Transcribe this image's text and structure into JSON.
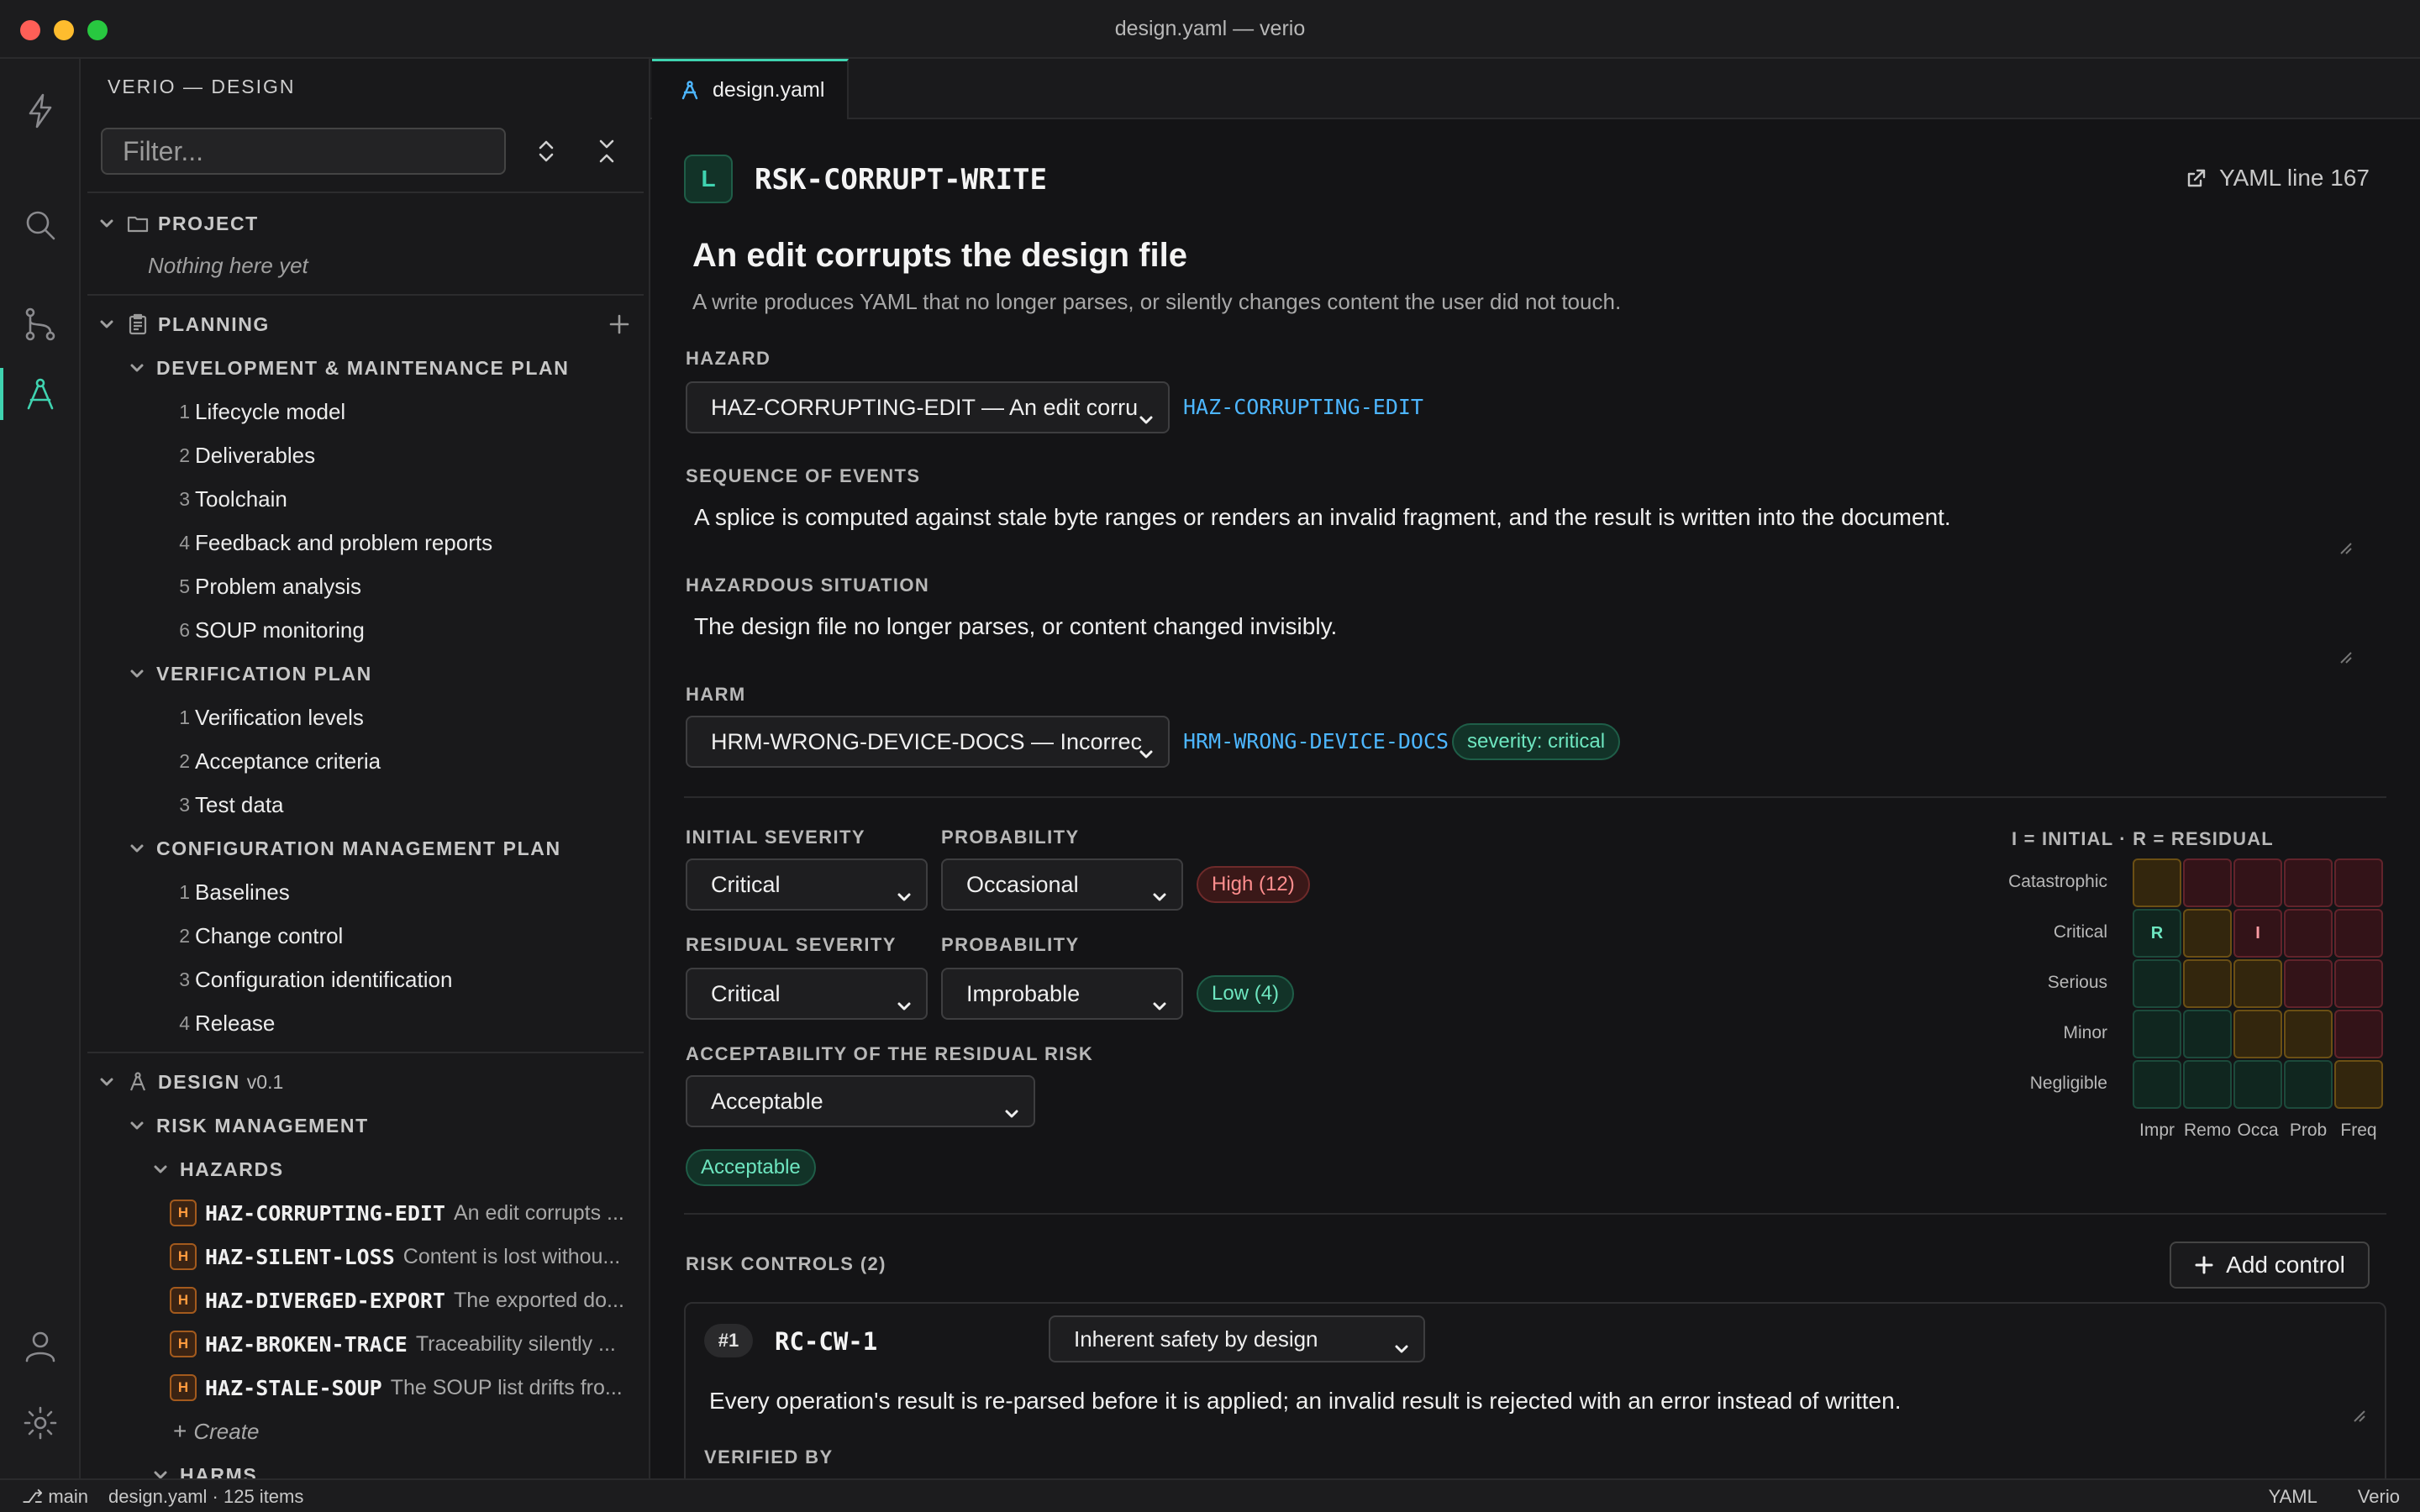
{
  "window": {
    "title": "design.yaml — verio"
  },
  "activity_bar": {
    "icons": [
      "bolt-icon",
      "search-icon",
      "source-control-icon",
      "design-compass-icon",
      "account-icon",
      "settings-icon"
    ],
    "active": "design-compass-icon",
    "accent_color": "#3fd3b0"
  },
  "sidebar": {
    "title": "VERIO — DESIGN",
    "filter_placeholder": "Filter...",
    "project": {
      "label": "PROJECT",
      "empty_text": "Nothing here yet"
    },
    "planning": {
      "label": "PLANNING",
      "groups": [
        {
          "label": "DEVELOPMENT & MAINTENANCE PLAN",
          "items": [
            {
              "num": "1",
              "label": "Lifecycle model"
            },
            {
              "num": "2",
              "label": "Deliverables"
            },
            {
              "num": "3",
              "label": "Toolchain"
            },
            {
              "num": "4",
              "label": "Feedback and problem reports"
            },
            {
              "num": "5",
              "label": "Problem analysis"
            },
            {
              "num": "6",
              "label": "SOUP monitoring"
            }
          ]
        },
        {
          "label": "VERIFICATION PLAN",
          "items": [
            {
              "num": "1",
              "label": "Verification levels"
            },
            {
              "num": "2",
              "label": "Acceptance criteria"
            },
            {
              "num": "3",
              "label": "Test data"
            }
          ]
        },
        {
          "label": "CONFIGURATION MANAGEMENT PLAN",
          "items": [
            {
              "num": "1",
              "label": "Baselines"
            },
            {
              "num": "2",
              "label": "Change control"
            },
            {
              "num": "3",
              "label": "Configuration identification"
            },
            {
              "num": "4",
              "label": "Release"
            }
          ]
        }
      ]
    },
    "design": {
      "label": "DESIGN",
      "version": "v0.1",
      "risk_management": "RISK MANAGEMENT",
      "hazards_label": "HAZARDS",
      "hazards": [
        {
          "badge": "H",
          "id": "HAZ-CORRUPTING-EDIT",
          "desc": "An edit corrupts ..."
        },
        {
          "badge": "H",
          "id": "HAZ-SILENT-LOSS",
          "desc": "Content is lost withou..."
        },
        {
          "badge": "H",
          "id": "HAZ-DIVERGED-EXPORT",
          "desc": "The exported do..."
        },
        {
          "badge": "H",
          "id": "HAZ-BROKEN-TRACE",
          "desc": "Traceability silently ..."
        },
        {
          "badge": "H",
          "id": "HAZ-STALE-SOUP",
          "desc": "The SOUP list drifts fro..."
        }
      ],
      "create_label": "Create",
      "harms_label": "HARMS"
    }
  },
  "tab": {
    "label": "design.yaml"
  },
  "risk": {
    "badge": "L",
    "id": "RSK-CORRUPT-WRITE",
    "yaml_link": "YAML line 167",
    "title": "An edit corrupts the design file",
    "subtitle": "A write produces YAML that no longer parses, or silently changes content the user did not touch.",
    "hazard": {
      "label": "HAZARD",
      "selected": "HAZ-CORRUPTING-EDIT — An edit corru",
      "ref": "HAZ-CORRUPTING-EDIT"
    },
    "sequence": {
      "label": "SEQUENCE OF EVENTS",
      "text": "A splice is computed against stale byte ranges or renders an invalid fragment, and the result is written into the document."
    },
    "hazardous_situation": {
      "label": "HAZARDOUS SITUATION",
      "text": "The design file no longer parses, or content changed invisibly."
    },
    "harm": {
      "label": "HARM",
      "selected": "HRM-WRONG-DEVICE-DOCS — Incorrec",
      "ref": "HRM-WRONG-DEVICE-DOCS",
      "severity_badge": "severity: critical"
    },
    "initial": {
      "severity_label": "INITIAL SEVERITY",
      "severity": "Critical",
      "probability_label": "PROBABILITY",
      "probability": "Occasional",
      "level": "High (12)"
    },
    "residual": {
      "severity_label": "RESIDUAL SEVERITY",
      "severity": "Critical",
      "probability_label": "PROBABILITY",
      "probability": "Improbable",
      "level": "Low (4)"
    },
    "acceptability": {
      "label": "ACCEPTABILITY OF THE RESIDUAL RISK",
      "selected": "Acceptable",
      "badge": "Acceptable"
    },
    "matrix": {
      "legend": "I = INITIAL · R = RESIDUAL",
      "rows": [
        "Catastrophic",
        "Critical",
        "Serious",
        "Minor",
        "Negligible"
      ],
      "cols": [
        "Impr",
        "Remo",
        "Occa",
        "Prob",
        "Freq"
      ],
      "colors": {
        "green": "#1c4a3b",
        "amber": "#6b4f14",
        "red": "#62232b"
      },
      "cells": [
        [
          "amber",
          "red",
          "red",
          "red",
          "red"
        ],
        [
          "green",
          "amber",
          "red",
          "red",
          "red"
        ],
        [
          "green",
          "amber",
          "amber",
          "red",
          "red"
        ],
        [
          "green",
          "green",
          "amber",
          "amber",
          "red"
        ],
        [
          "green",
          "green",
          "green",
          "green",
          "amber"
        ]
      ],
      "markers": {
        "initial": "I",
        "residual": "R"
      }
    },
    "controls": {
      "label": "RISK CONTROLS (2)",
      "add_label": "Add control",
      "items": [
        {
          "num": "#1",
          "id": "RC-CW-1",
          "type": "Inherent safety by design",
          "text": "Every operation's result is re-parsed before it is applied; an invalid result is rejected with an error instead of written.",
          "verified_by_label": "VERIFIED BY"
        }
      ]
    }
  },
  "status_bar": {
    "branch": "main",
    "info": "design.yaml · 125 items",
    "language": "YAML",
    "app": "Verio"
  }
}
